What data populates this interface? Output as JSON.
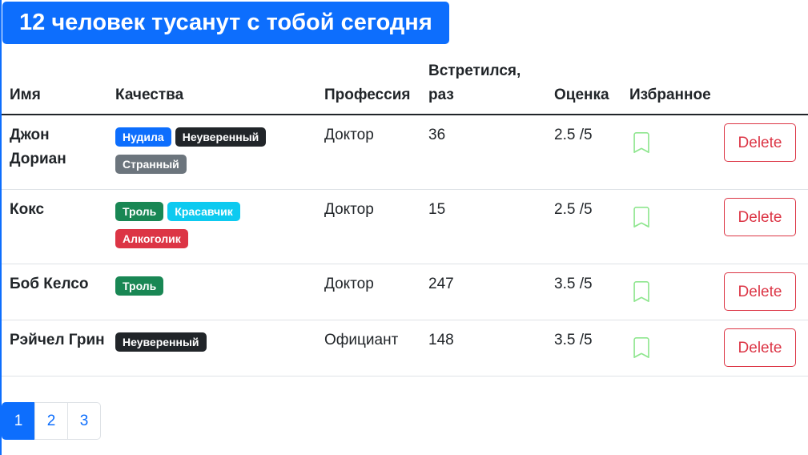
{
  "headline": "12 человек тусанут с тобой сегодня",
  "table": {
    "headers": {
      "name": "Имя",
      "qualities": "Качества",
      "profession": "Профессия",
      "met": "Встретился, раз",
      "rating": "Оценка",
      "favorite": "Избранное"
    },
    "rows": [
      {
        "name": "Джон Дориан",
        "qualities": [
          {
            "label": "Нудила",
            "color": "#0d6efd"
          },
          {
            "label": "Неуверенный",
            "color": "#212529"
          },
          {
            "label": "Странный",
            "color": "#6c757d"
          }
        ],
        "profession": "Доктор",
        "met": "36",
        "rating": "2.5 /5",
        "favorite_icon": "bookmark-icon",
        "delete_label": "Delete"
      },
      {
        "name": "Кокс",
        "qualities": [
          {
            "label": "Троль",
            "color": "#198754"
          },
          {
            "label": "Красавчик",
            "color": "#0dcaf0"
          },
          {
            "label": "Алкоголик",
            "color": "#dc3545"
          }
        ],
        "profession": "Доктор",
        "met": "15",
        "rating": "2.5 /5",
        "favorite_icon": "bookmark-icon",
        "delete_label": "Delete"
      },
      {
        "name": "Боб Келсо",
        "qualities": [
          {
            "label": "Троль",
            "color": "#198754"
          }
        ],
        "profession": "Доктор",
        "met": "247",
        "rating": "3.5 /5",
        "favorite_icon": "bookmark-icon",
        "delete_label": "Delete"
      },
      {
        "name": "Рэйчел Грин",
        "qualities": [
          {
            "label": "Неуверенный",
            "color": "#212529"
          }
        ],
        "profession": "Официант",
        "met": "148",
        "rating": "3.5 /5",
        "favorite_icon": "bookmark-icon",
        "delete_label": "Delete"
      }
    ]
  },
  "pagination": {
    "pages": [
      "1",
      "2",
      "3"
    ],
    "active": "1"
  },
  "colors": {
    "primary": "#0d6efd",
    "danger": "#dc3545",
    "bookmark": "#8ee68e"
  }
}
